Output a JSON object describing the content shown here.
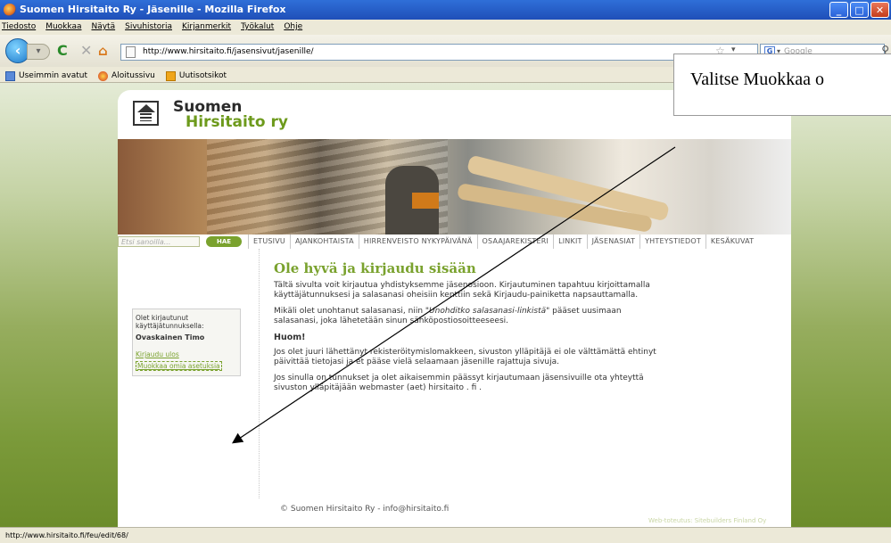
{
  "window": {
    "title": "Suomen Hirsitaito Ry - Jäsenille - Mozilla Firefox"
  },
  "menubar": [
    "Tiedosto",
    "Muokkaa",
    "Näytä",
    "Sivuhistoria",
    "Kirjanmerkit",
    "Työkalut",
    "Ohje"
  ],
  "navbar": {
    "url": "http://www.hirsitaito.fi/jasensivut/jasenille/",
    "search_placeholder": "Google"
  },
  "bookmarks": [
    "Useimmin avatut",
    "Aloitussivu",
    "Uutisotsikot"
  ],
  "site": {
    "logo_line1": "Suomen",
    "logo_line2": "Hirsitaito ry",
    "search_placeholder": "Etsi sanoilla...",
    "search_button": "HAE",
    "nav": [
      "ETUSIVU",
      "AJANKOHTAISTA",
      "HIRRENVEISTO NYKYPÄIVÄNÄ",
      "OSAAJAREKISTERI",
      "LINKIT",
      "JÄSENASIAT",
      "YHTEYSTIEDOT",
      "KESÄKUVAT"
    ],
    "login": {
      "label": "Olet kirjautunut käyttäjätunnuksella:",
      "name": "Ovaskainen Timo",
      "logout": "Kirjaudu ulos",
      "edit": "Muokkaa omia asetuksia"
    },
    "heading": "Ole hyvä ja kirjaudu sisään",
    "p1": "Tältä sivulta voit kirjautua yhdistyksemme jäsenosioon. Kirjautuminen tapahtuu kirjoittamalla käyttäjätunnuksesi ja salasanasi oheisiin kenttiin sekä Kirjaudu-painiketta napsauttamalla.",
    "p2_pre": "Mikäli olet unohtanut salasanasi, niin ",
    "p2_link": "\"Unohditko salasanasi-linkistä\"",
    "p2_post": " pääset uusimaan salasanasi, joka lähetetään sinun sähköpostiosoitteeseesi.",
    "huom": "Huom!",
    "p3": "Jos olet juuri lähettänyt rekisteröitymislomakkeen, sivuston ylläpitäjä ei ole välttämättä ehtinyt päivittää tietojasi ja et pääse vielä selaamaan jäsenille rajattuja sivuja.",
    "p4": "Jos sinulla on tunnukset ja olet aikaisemmin päässyt kirjautumaan jäsensivuille ota yhteyttä sivuston ylläpitäjään webmaster (aet) hirsitaito . fi .",
    "footer": "© Suomen Hirsitaito Ry - info@hirsitaito.fi",
    "watermark": "Web-toteutus: Sitebuilders Finland Oy"
  },
  "annotation": "Valitse Muokkaa o",
  "statusbar": "http://www.hirsitaito.fi/feu/edit/68/"
}
